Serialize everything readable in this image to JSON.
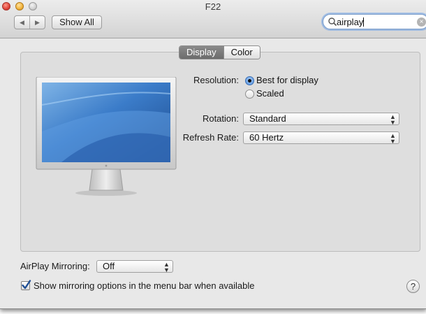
{
  "window": {
    "title": "F22",
    "toolbar": {
      "show_all_label": "Show All"
    },
    "search": {
      "value": "airplay"
    }
  },
  "tabs": [
    {
      "label": "Display"
    },
    {
      "label": "Color"
    }
  ],
  "display": {
    "resolution_label": "Resolution:",
    "resolution_options": [
      "Best for display",
      "Scaled"
    ],
    "rotation_label": "Rotation:",
    "rotation_value": "Standard",
    "refresh_label": "Refresh Rate:",
    "refresh_value": "60 Hertz"
  },
  "airplay": {
    "label": "AirPlay Mirroring:",
    "value": "Off",
    "checkbox_label": "Show mirroring options in the menu bar when available"
  },
  "help_label": "?",
  "colors": {
    "accent": "#4e8ee0",
    "search_focus": "#7a9cc9"
  },
  "icons": [
    "back-icon",
    "forward-icon",
    "search-icon",
    "clear-icon",
    "checkmark-icon",
    "help-icon",
    "monitor-icon"
  ]
}
